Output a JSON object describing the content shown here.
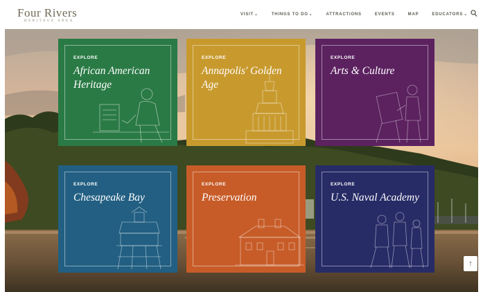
{
  "logo": {
    "main": "Four Rivers",
    "sub": "HERITAGE AREA"
  },
  "nav": [
    {
      "label": "VISIT",
      "dropdown": true
    },
    {
      "label": "THINGS TO DO",
      "dropdown": true
    },
    {
      "label": "ATTRACTIONS",
      "dropdown": false
    },
    {
      "label": "EVENTS",
      "dropdown": false
    },
    {
      "label": "MAP",
      "dropdown": false
    },
    {
      "label": "EDUCATORS",
      "dropdown": true
    }
  ],
  "icons": {
    "search": "search-icon",
    "scroll_top": "arrow-up-icon"
  },
  "scroll_top_glyph": "↑",
  "tiles": [
    {
      "kicker": "EXPLORE",
      "title": "African American Heritage",
      "color": "#2a7a45",
      "art": "man-reading-illustration"
    },
    {
      "kicker": "EXPLORE",
      "title": "Annapolis' Golden Age",
      "color": "#c89a2e",
      "art": "state-house-dome-illustration"
    },
    {
      "kicker": "EXPLORE",
      "title": "Arts & Culture",
      "color": "#5c2260",
      "art": "painter-illustration"
    },
    {
      "kicker": "EXPLORE",
      "title": "Chesapeake Bay",
      "color": "#225f82",
      "art": "lighthouse-illustration"
    },
    {
      "kicker": "EXPLORE",
      "title": "Preservation",
      "color": "#c75c28",
      "art": "historic-house-illustration"
    },
    {
      "kicker": "EXPLORE",
      "title": "U.S. Naval Academy",
      "color": "#272b66",
      "art": "midshipmen-illustration"
    }
  ]
}
